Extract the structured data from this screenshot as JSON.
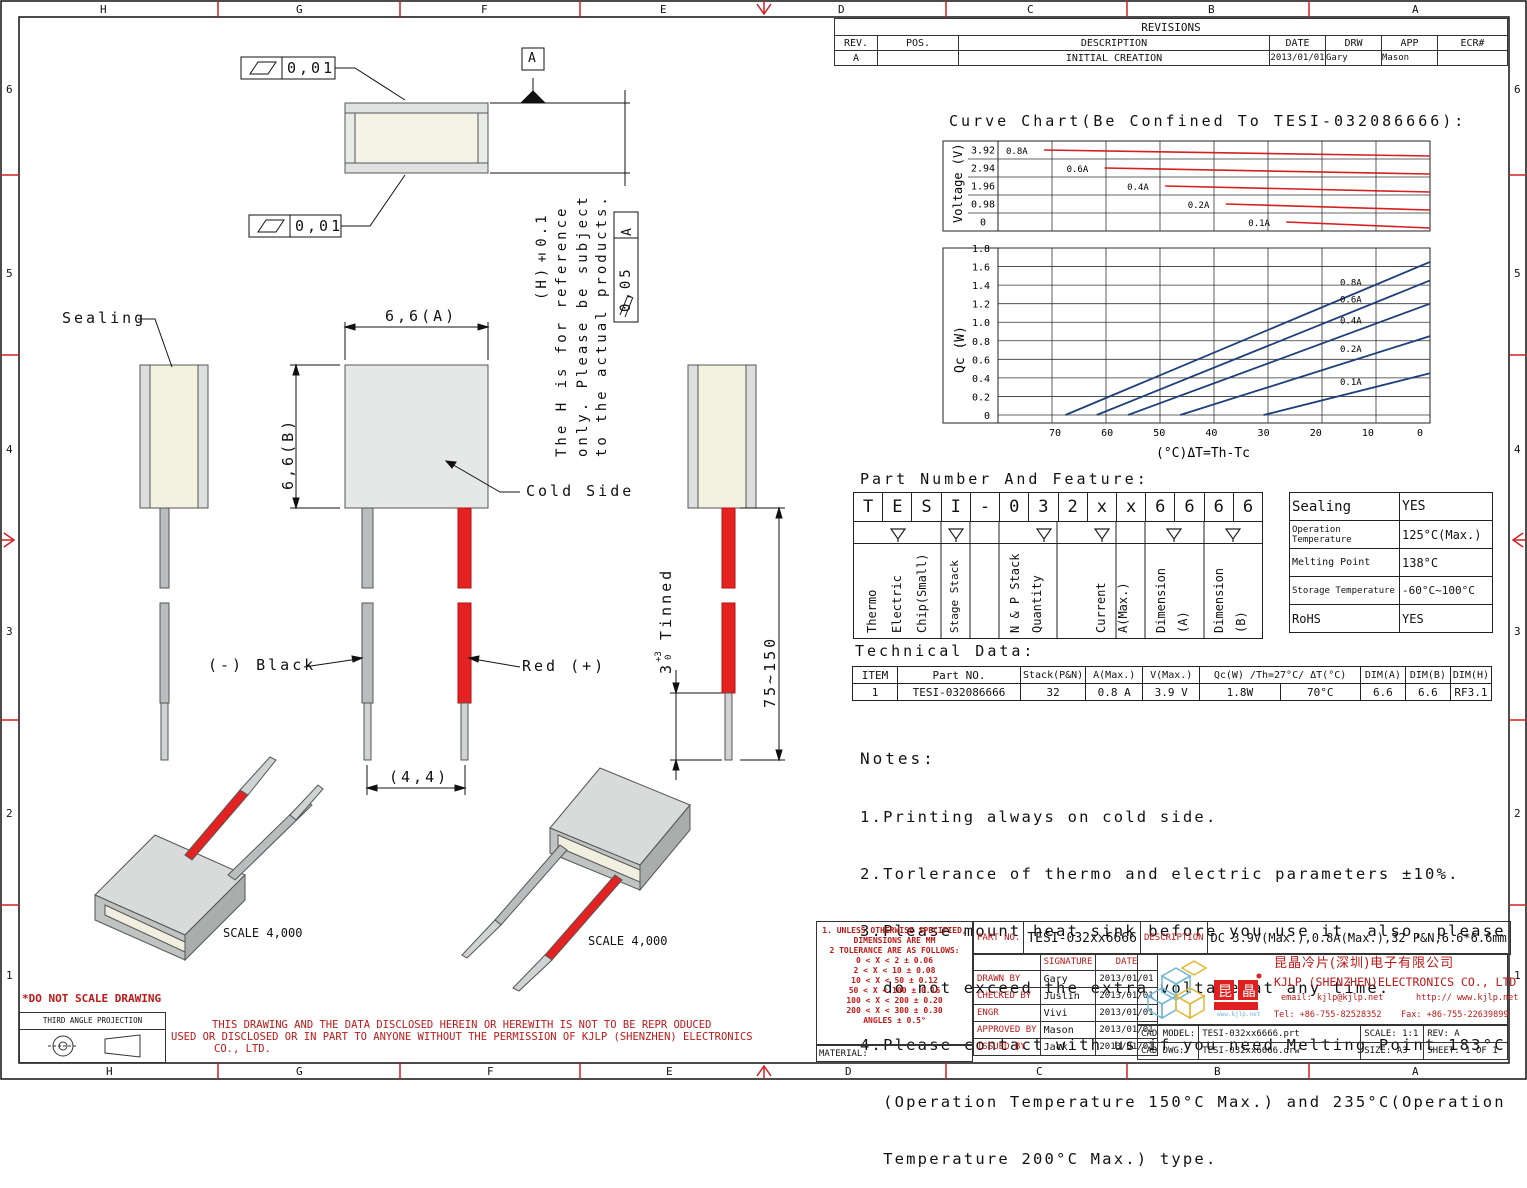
{
  "frame": {
    "columns": [
      "H",
      "G",
      "F",
      "E",
      "D",
      "C",
      "B",
      "A"
    ],
    "rows": [
      "6",
      "5",
      "4",
      "3",
      "2",
      "1"
    ]
  },
  "revisions": {
    "title": "REVISIONS",
    "headers": [
      "REV.",
      "POS.",
      "DESCRIPTION",
      "DATE",
      "DRW",
      "APP",
      "ECR#"
    ],
    "row": [
      "A",
      "",
      "INITIAL CREATION",
      "2013/01/01",
      "Gary",
      "Mason",
      ""
    ]
  },
  "drawing": {
    "flatness_1": "0,01",
    "flatness_2": "0,01",
    "datum": "A",
    "parallel_tol": "0,05",
    "parallel_datum": "A",
    "h_note_1": "(H)±0.1",
    "h_note_2": "The H is for reference",
    "h_note_3": "only. Please be subject",
    "h_note_4": "to the actual products.",
    "sealing": "Sealing",
    "dim_a": "6,6(A)",
    "dim_b": "6,6(B)",
    "cold_side": "Cold Side",
    "black": "(-) Black",
    "red": "Red (+)",
    "lead_pitch": "(4,4)",
    "tinned": "Tinned",
    "tinned_len": "3",
    "tinned_tol_up": "+3",
    "tinned_tol_dn": "0",
    "lead_len": "75~150",
    "scale_1": "SCALE  4,000",
    "scale_2": "SCALE  4,000"
  },
  "curve_title": "Curve Chart(Be Confined To TESI-032086666):",
  "chart_data": [
    {
      "type": "line",
      "ylabel": "Voltage (V)",
      "yticks": [
        "3.92",
        "2.94",
        "1.96",
        "0.98",
        "0"
      ],
      "series": [
        {
          "name": "0.8A",
          "x": [
            70,
            0
          ],
          "y": [
            3.92,
            3.55
          ]
        },
        {
          "name": "0.6A",
          "x": [
            60,
            0
          ],
          "y": [
            2.94,
            2.6
          ]
        },
        {
          "name": "0.4A",
          "x": [
            50,
            0
          ],
          "y": [
            1.96,
            1.75
          ]
        },
        {
          "name": "0.2A",
          "x": [
            40,
            0
          ],
          "y": [
            0.98,
            0.85
          ]
        },
        {
          "name": "0.1A",
          "x": [
            30,
            0
          ],
          "y": [
            0.49,
            0.33
          ]
        }
      ],
      "color": "#d42020"
    },
    {
      "type": "line",
      "xlabel": "(°C)ΔT=Th-Tc",
      "ylabel": "Qc (W)",
      "xticks": [
        "70",
        "60",
        "50",
        "40",
        "30",
        "20",
        "10",
        "0"
      ],
      "yticks": [
        "1.8",
        "1.6",
        "1.4",
        "1.2",
        "1.0",
        "0.8",
        "0.6",
        "0.4",
        "0.2",
        "0"
      ],
      "xlim": [
        70,
        0
      ],
      "ylim": [
        0,
        1.8
      ],
      "series": [
        {
          "name": "0.8A",
          "x": [
            68,
            0
          ],
          "y": [
            0,
            1.65
          ]
        },
        {
          "name": "0.6A",
          "x": [
            62,
            0
          ],
          "y": [
            0,
            1.45
          ]
        },
        {
          "name": "0.4A",
          "x": [
            56,
            0
          ],
          "y": [
            0,
            1.2
          ]
        },
        {
          "name": "0.2A",
          "x": [
            46,
            0
          ],
          "y": [
            0,
            0.85
          ]
        },
        {
          "name": "0.1A",
          "x": [
            30,
            0
          ],
          "y": [
            0,
            0.45
          ]
        }
      ],
      "color": "#1e3f7a"
    }
  ],
  "part_number": {
    "title": "Part Number And Feature:",
    "chars": [
      "T",
      "E",
      "S",
      "I",
      "-",
      "0",
      "3",
      "2",
      "x",
      "x",
      "6",
      "6",
      "6",
      "6"
    ],
    "groups": [
      "Thermo Electric Chip(Small)",
      "Stage Stack",
      "N & P Stack Quantity",
      "Current A(Max.)",
      "Dimension (A)",
      "Dimension (B)"
    ],
    "features": [
      [
        "Sealing",
        "YES"
      ],
      [
        "Operation Temperature",
        "125°C(Max.)"
      ],
      [
        "Melting Point",
        "138°C"
      ],
      [
        "Storage Temperature",
        "-60°C~100°C"
      ],
      [
        "RoHS",
        "YES"
      ]
    ]
  },
  "technical": {
    "title": "Technical Data:",
    "headers": [
      "ITEM",
      "Part NO.",
      "Stack(P&N)",
      "A(Max.)",
      "V(Max.)",
      "Qc(W) /Th=27°C/ ΔT(°C)",
      "DIM(A)",
      "DIM(B)",
      "DIM(H)"
    ],
    "row": [
      "1",
      "TESI-032086666",
      "32",
      "0.8 A",
      "3.9 V",
      "1.8W",
      "70°C",
      "6.6",
      "6.6",
      "RF3.1"
    ]
  },
  "notes": {
    "title": "Notes:",
    "lines": [
      "1.Printing always on cold side.",
      "2.Torlerance of thermo and electric parameters ±10%.",
      "3.Please mount heat sink before you use it. also, please",
      "  do not exceed the extra voltage at any time.",
      "4.Please contact with us if you need Melting Point 183°C",
      "  (Operation Temperature 150°C Max.) and 235°C(Operation",
      "  Temperature 200°C Max.) type."
    ]
  },
  "title_block": {
    "tol_lines": [
      "1. UNLESS OTHERWISE SPECIFIED,",
      "DIMENSIONS ARE MM",
      "2 TOLERANCE ARE AS FOLLOWS:",
      "0 < X <   2  ± 0.06",
      "2 < X <  10  ± 0.08",
      "10 < X <  50  ± 0.12",
      "50 < X < 100  ± 0.16",
      "100 < X < 200  ± 0.20",
      "200 < X < 300  ± 0.30",
      "ANGLES ± 0.5°"
    ],
    "material": "MATERIAL:",
    "part_no_label": "PART NO.",
    "part_no": "TESI-032xx6666",
    "desc_label": "DESCRIPTION",
    "desc": "DC 3.9V(Max.),0.8A(Max.),32 P&N,6.6*6.6mm",
    "sig_header": [
      "SIGNATURE",
      "DATE"
    ],
    "sig_rows": [
      [
        "DRAWN BY",
        "Gary",
        "2013/01/01"
      ],
      [
        "CHECKED BY",
        "Juslin",
        "2013/01/01"
      ],
      [
        "ENGR",
        "Vivi",
        "2013/01/01"
      ],
      [
        "APPROVED BY",
        "Mason",
        "2013/01/01"
      ],
      [
        "ISSUED BY",
        "Jack",
        "2013/01/01"
      ]
    ],
    "company_cn": "昆晶冷片(深圳)电子有限公司",
    "company_en": "KJLP (SHENZHEN)ELECTRONICS CO., LTD",
    "email": "email: kjlp@kjlp.net",
    "http": "http:// www.kjlp.net",
    "tel": "Tel: +86-755-82528352",
    "fax": "Fax: +86-755-22639899",
    "logo_url": "www.kjlp.net",
    "cad_model_label": "CAD MODEL:",
    "cad_model": "TESI-032xx6666.prt",
    "scale_label": "SCALE: 1:1",
    "rev_label": "REV: A",
    "cad_dwg_label": "CAD DWG:",
    "cad_dwg": "TESI-032xx6666.drw",
    "size_label": "SIZE: A3",
    "sheet_label": "SHEET: 1 OF 1",
    "do_not_scale": "*DO NOT SCALE DRAWING",
    "third_angle": "THIRD ANGLE PROJECTION",
    "disclaimer_1": "THIS DRAWING AND THE DATA DISCLOSED HEREIN OR HEREWITH IS NOT TO BE REPR ODUCED",
    "disclaimer_2": "USED OR DISCLOSED OR IN PART TO ANYONE WITHOUT THE PERMISSION OF KJLP (SHENZHEN) ELECTRONICS",
    "disclaimer_3": "CO., LTD."
  }
}
